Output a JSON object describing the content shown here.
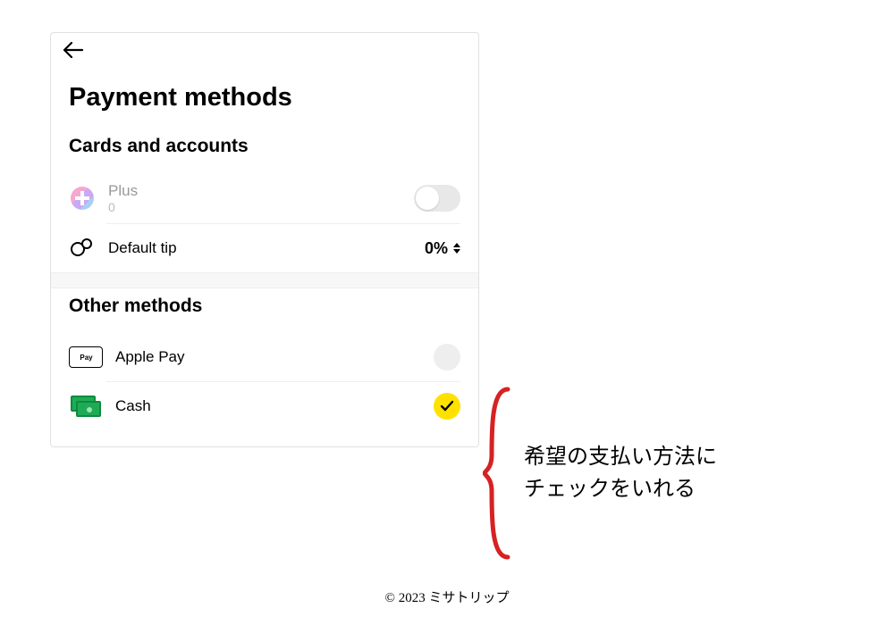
{
  "header": {
    "title": "Payment methods"
  },
  "cards_section": {
    "title": "Cards and accounts",
    "plus": {
      "label": "Plus",
      "sub": "0"
    },
    "tip": {
      "label": "Default tip",
      "value": "0%"
    }
  },
  "other_section": {
    "title": "Other methods",
    "apple_pay": {
      "label": "Apple Pay",
      "badge": "Pay"
    },
    "cash": {
      "label": "Cash"
    }
  },
  "annotation": {
    "line1": "希望の支払い方法に",
    "line2": "チェックをいれる"
  },
  "footer": {
    "copyright": "© 2023 ミサトリップ"
  }
}
